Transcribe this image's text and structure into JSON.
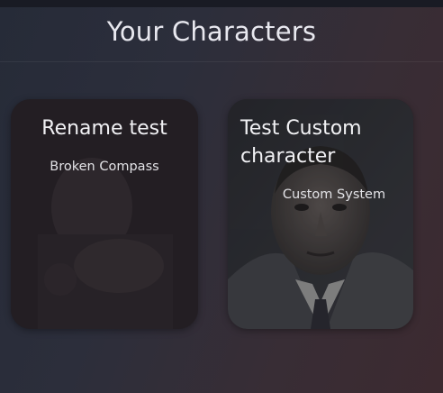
{
  "page": {
    "title": "Your Characters"
  },
  "characters": [
    {
      "name": "Rename test",
      "system": "Broken Compass",
      "portrait_icon": "faded-figure-portrait"
    },
    {
      "name": "Test Custom character",
      "system": "Custom System",
      "portrait_icon": "man-in-suit-portrait"
    }
  ],
  "colors": {
    "background_left": "#262b38",
    "background_right": "#3c2a30",
    "card_bg": "#201c21",
    "text": "#e8e8ef"
  }
}
